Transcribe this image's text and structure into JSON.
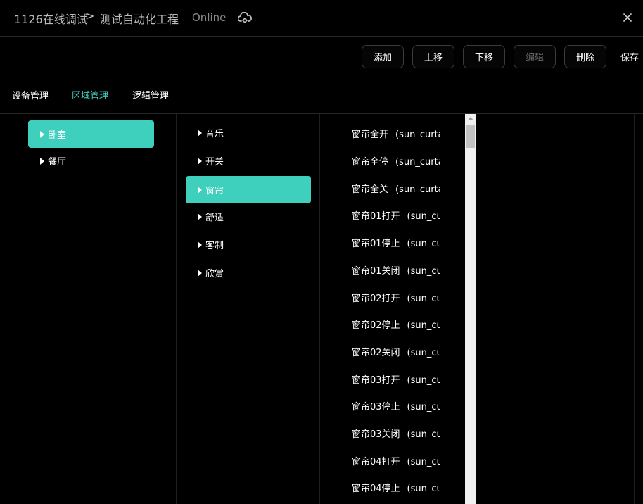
{
  "header": {
    "project": "1126在线调试",
    "separator": ">",
    "page": "测试自动化工程",
    "status": "Online",
    "cloud_icon": "cloud-sync-icon",
    "close_icon": "close-icon"
  },
  "toolbar": {
    "add": "添加",
    "move_up": "上移",
    "move_down": "下移",
    "edit": "编辑",
    "delete": "删除",
    "save": "保存"
  },
  "tabs": [
    "设备管理",
    "区域管理",
    "逻辑管理"
  ],
  "active_tab": "区域管理",
  "areas": [
    "卧室",
    "餐厅"
  ],
  "selected_area": "卧室",
  "groups": [
    "音乐",
    "开关",
    "窗帘",
    "舒适",
    "客制",
    "欣赏"
  ],
  "selected_group": "窗帘",
  "commands": [
    {
      "name": "窗帘全开",
      "code": "(sun_curta"
    },
    {
      "name": "窗帘全停",
      "code": "(sun_curta"
    },
    {
      "name": "窗帘全关",
      "code": "(sun_curta"
    },
    {
      "name": "窗帘01打开",
      "code": "(sun_cur"
    },
    {
      "name": "窗帘01停止",
      "code": "(sun_cur"
    },
    {
      "name": "窗帘01关闭",
      "code": "(sun_cur"
    },
    {
      "name": "窗帘02打开",
      "code": "(sun_cu"
    },
    {
      "name": "窗帘02停止",
      "code": "(sun_cu"
    },
    {
      "name": "窗帘02关闭",
      "code": "(sun_cu"
    },
    {
      "name": "窗帘03打开",
      "code": "(sun_cu"
    },
    {
      "name": "窗帘03停止",
      "code": "(sun_cu"
    },
    {
      "name": "窗帘03关闭",
      "code": "(sun_cu"
    },
    {
      "name": "窗帘04打开",
      "code": "(sun_cu"
    },
    {
      "name": "窗帘04停止",
      "code": "(sun_cu"
    }
  ],
  "colors": {
    "accent": "#3ecfbd",
    "background": "#000000",
    "border": "#262626",
    "button_border": "#3a3a3a"
  }
}
